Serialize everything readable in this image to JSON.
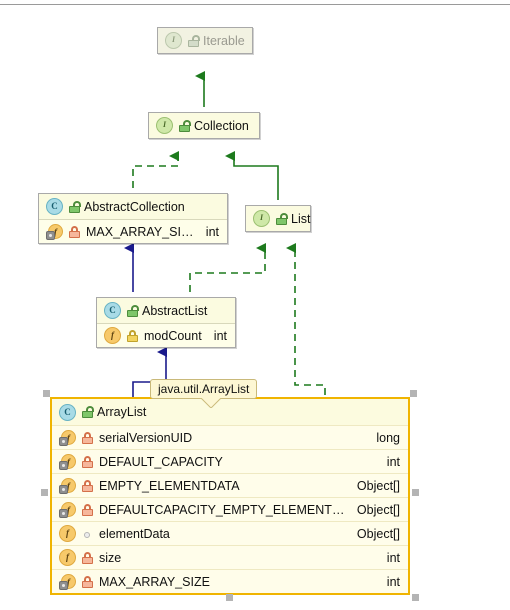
{
  "diagram": {
    "kind": "uml-class-diagram",
    "tooltip": {
      "label": "java.util.ArrayList"
    },
    "types": {
      "int": "int",
      "long": "long",
      "object_array": "Object[]"
    },
    "nodes": [
      {
        "id": "iterable",
        "name": "Iterable",
        "stereotype_icon": "interface-icon",
        "visibility_icon": "public-lock-icon",
        "dimmed": true,
        "members": []
      },
      {
        "id": "collection",
        "name": "Collection",
        "stereotype_icon": "interface-icon",
        "visibility_icon": "public-lock-icon",
        "dimmed": false,
        "members": []
      },
      {
        "id": "abstractcollection",
        "name": "AbstractCollection",
        "stereotype_icon": "class-icon",
        "visibility_icon": "public-lock-icon",
        "dimmed": false,
        "members": [
          {
            "name": "MAX_ARRAY_SIZE",
            "type": "int",
            "member_icon": "static-field-icon",
            "visibility_icon": "private-lock-icon"
          }
        ]
      },
      {
        "id": "list",
        "name": "List",
        "stereotype_icon": "interface-icon",
        "visibility_icon": "public-lock-icon",
        "dimmed": false,
        "members": []
      },
      {
        "id": "abstractlist",
        "name": "AbstractList",
        "stereotype_icon": "class-icon",
        "visibility_icon": "public-lock-icon",
        "dimmed": false,
        "members": [
          {
            "name": "modCount",
            "type": "int",
            "member_icon": "field-icon",
            "visibility_icon": "protected-lock-icon"
          }
        ]
      },
      {
        "id": "arraylist",
        "name": "ArrayList",
        "stereotype_icon": "class-icon",
        "visibility_icon": "public-lock-icon",
        "selected": true,
        "members": [
          {
            "name": "serialVersionUID",
            "type": "long",
            "member_icon": "static-field-icon",
            "visibility_icon": "private-lock-icon"
          },
          {
            "name": "DEFAULT_CAPACITY",
            "type": "int",
            "member_icon": "static-field-icon",
            "visibility_icon": "private-lock-icon"
          },
          {
            "name": "EMPTY_ELEMENTDATA",
            "type": "Object[]",
            "member_icon": "static-field-icon",
            "visibility_icon": "private-lock-icon"
          },
          {
            "name": "DEFAULTCAPACITY_EMPTY_ELEMENTDATA",
            "type": "Object[]",
            "member_icon": "static-field-icon",
            "visibility_icon": "private-lock-icon"
          },
          {
            "name": "elementData",
            "type": "Object[]",
            "member_icon": "field-icon",
            "visibility_icon": "package-private-icon"
          },
          {
            "name": "size",
            "type": "int",
            "member_icon": "field-icon",
            "visibility_icon": "private-lock-icon"
          },
          {
            "name": "MAX_ARRAY_SIZE",
            "type": "int",
            "member_icon": "static-field-icon",
            "visibility_icon": "private-lock-icon"
          }
        ]
      }
    ],
    "edges": [
      {
        "from": "collection",
        "to": "iterable",
        "relation": "extends",
        "style": "solid",
        "color": "#1d7a1d"
      },
      {
        "from": "abstractcollection",
        "to": "collection",
        "relation": "implements",
        "style": "dashed",
        "color": "#1d7a1d"
      },
      {
        "from": "list",
        "to": "collection",
        "relation": "extends",
        "style": "solid",
        "color": "#1d7a1d"
      },
      {
        "from": "abstractlist",
        "to": "abstractcollection",
        "relation": "extends",
        "style": "solid",
        "color": "#1a1a8c"
      },
      {
        "from": "abstractlist",
        "to": "list",
        "relation": "implements",
        "style": "dashed",
        "color": "#1d7a1d"
      },
      {
        "from": "arraylist",
        "to": "abstractlist",
        "relation": "extends",
        "style": "solid",
        "color": "#1a1a8c"
      },
      {
        "from": "arraylist",
        "to": "list",
        "relation": "implements",
        "style": "dashed",
        "color": "#1d7a1d"
      }
    ],
    "colors": {
      "node_fill": "#fbfbe4",
      "node_border": "#a9a9a9",
      "selection_border": "#f0b400",
      "inheritance_green": "#1d7a1d",
      "inheritance_blue": "#1a1a8c",
      "handle": "#b4b4b4"
    }
  }
}
